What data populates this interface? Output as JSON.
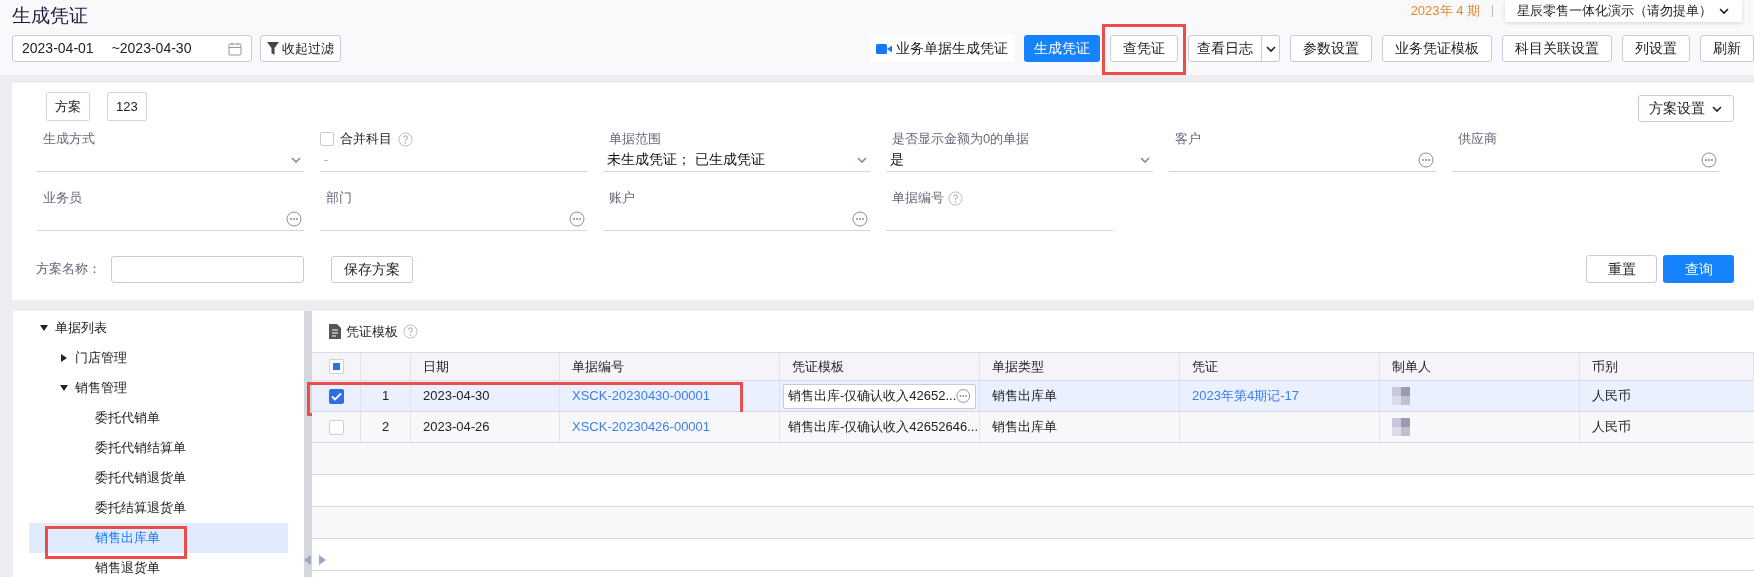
{
  "header": {
    "title": "生成凭证",
    "period": "2023年 4 期",
    "org": "星辰零售一体化演示（请勿提单）",
    "date_start": "2023-04-01",
    "date_end": "~2023-04-30",
    "collapse_filter": "收起过滤"
  },
  "toolbar": [
    {
      "label": "业务单据生成凭证",
      "kind": "video",
      "highlighted": false
    },
    {
      "label": "生成凭证",
      "kind": "primary",
      "highlighted": false
    },
    {
      "label": "查凭证",
      "kind": "default",
      "highlighted": true
    },
    {
      "label": "查看日志",
      "kind": "split",
      "highlighted": false
    },
    {
      "label": "参数设置",
      "kind": "default",
      "highlighted": false
    },
    {
      "label": "业务凭证模板",
      "kind": "default",
      "highlighted": false
    },
    {
      "label": "科目关联设置",
      "kind": "default",
      "highlighted": false
    },
    {
      "label": "列设置",
      "kind": "default",
      "highlighted": false
    },
    {
      "label": "刷新",
      "kind": "default",
      "highlighted": false
    }
  ],
  "filter": {
    "tabs": [
      "方案",
      "123"
    ],
    "scheme_settings": "方案设置",
    "fields": [
      {
        "label": "生成方式",
        "kind": "select"
      },
      {
        "label": "合并科目",
        "kind": "checkbox",
        "checked": false,
        "placeholder": "-"
      },
      {
        "label": "单据范围",
        "kind": "select",
        "value": "未生成凭证；  已生成凭证"
      },
      {
        "label": "是否显示金额为0的单据",
        "kind": "select",
        "value": "是"
      },
      {
        "label": "客户",
        "kind": "lookup"
      },
      {
        "label": "供应商",
        "kind": "lookup"
      },
      {
        "label": "业务员",
        "kind": "lookup"
      },
      {
        "label": "部门",
        "kind": "lookup"
      },
      {
        "label": "账户",
        "kind": "lookup"
      },
      {
        "label": "单据编号",
        "kind": "text"
      }
    ],
    "scheme_name_label": "方案名称：",
    "save_scheme": "保存方案",
    "reset": "重置",
    "query": "查询"
  },
  "tree": [
    {
      "label": "单据列表",
      "expanded": true,
      "selected": false,
      "highlighted": false,
      "children": [
        {
          "label": "门店管理",
          "expanded": false,
          "selected": false,
          "highlighted": false
        },
        {
          "label": "销售管理",
          "expanded": true,
          "selected": false,
          "highlighted": false,
          "children": [
            {
              "label": "委托代销单",
              "selected": false,
              "highlighted": false
            },
            {
              "label": "委托代销结算单",
              "selected": false,
              "highlighted": false
            },
            {
              "label": "委托代销退货单",
              "selected": false,
              "highlighted": false
            },
            {
              "label": "委托结算退货单",
              "selected": false,
              "highlighted": false
            },
            {
              "label": "销售出库单",
              "selected": true,
              "highlighted": true
            },
            {
              "label": "销售退货单",
              "selected": false,
              "highlighted": false
            }
          ]
        }
      ]
    }
  ],
  "grid": {
    "title": "凭证模板",
    "header_indeterminate": true,
    "columns": [
      "日期",
      "单据编号",
      "凭证模板",
      "单据类型",
      "凭证",
      "制单人",
      "币别"
    ],
    "rows": [
      {
        "index": "1",
        "checked": true,
        "selected": true,
        "highlighted": true,
        "date": "2023-04-30",
        "bill_no": "XSCK-20230430-00001",
        "template": "销售出库-仅确认收入42652...",
        "editing": true,
        "bill_type": "销售出库单",
        "voucher": "2023年第4期记-17",
        "maker_redacted": true,
        "currency": "人民币"
      },
      {
        "index": "2",
        "checked": false,
        "selected": false,
        "highlighted": false,
        "date": "2023-04-26",
        "bill_no": "XSCK-20230426-00001",
        "template": "销售出库-仅确认收入42652646...",
        "editing": false,
        "bill_type": "销售出库单",
        "maker_redacted": true,
        "currency": "人民币"
      }
    ]
  }
}
